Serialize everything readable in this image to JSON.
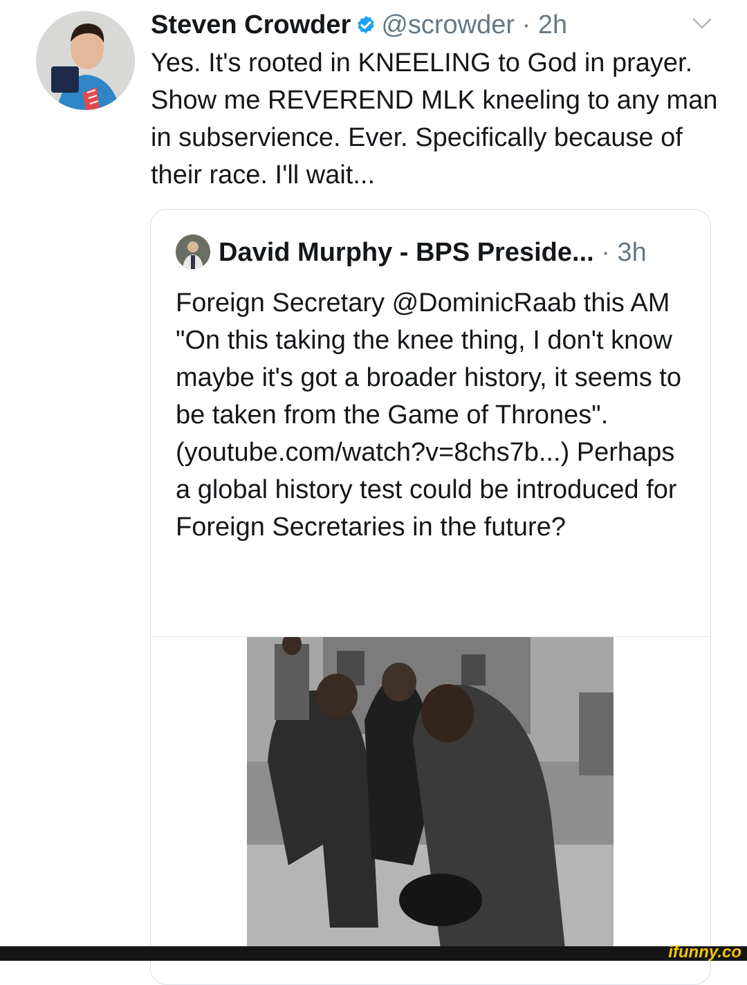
{
  "tweet": {
    "author_name": "Steven Crowder",
    "handle": "@scrowder",
    "separator": "·",
    "time": "2h",
    "text": "Yes. It's rooted in KNEELING to God in prayer. Show me REVEREND MLK kneeling to any man in subservience. Ever. Specifically because of their race. I'll wait..."
  },
  "quoted_tweet": {
    "author_name": "David Murphy - BPS Preside...",
    "separator": "·",
    "time": "3h",
    "text": "Foreign Secretary @DominicRaab this AM \"On this taking the knee thing, I don't know maybe it's got a broader history, it seems to be taken from the Game of Thrones\". (youtube.com/watch?v=8chs7b...) Perhaps a global history test could be introduced for Foreign Secretaries in the future?"
  },
  "watermark": "ifunny.co",
  "icons": {
    "verified": "verified-badge-icon",
    "more": "chevron-down-icon"
  },
  "colors": {
    "verified": "#1da1f2",
    "secondary_text": "#657786",
    "primary_text": "#14171a",
    "border": "#d9dfe4",
    "watermark": "#f5c400"
  }
}
